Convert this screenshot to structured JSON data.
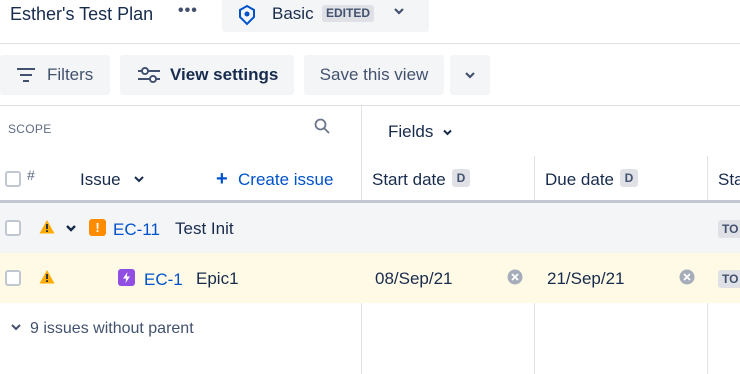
{
  "header": {
    "plan_title": "Esther's Test Plan",
    "more_label": "•••",
    "view_name": "Basic",
    "view_badge": "EDITED"
  },
  "toolbar": {
    "filters_label": "Filters",
    "view_settings_label": "View settings",
    "save_view_label": "Save this view"
  },
  "scope": {
    "label": "SCOPE",
    "hash_label": "#",
    "issue_label": "Issue",
    "create_issue_label": "Create issue"
  },
  "fields": {
    "button_label": "Fields",
    "columns": [
      {
        "label": "Start date",
        "badge": "D"
      },
      {
        "label": "Due date",
        "badge": "D"
      },
      {
        "label": "Sta"
      }
    ]
  },
  "rows": [
    {
      "key": "EC-11",
      "summary": "Test Init",
      "type_icon": "story-icon",
      "status": "TO"
    },
    {
      "key": "EC-1",
      "summary": "Epic1",
      "type_icon": "epic-icon",
      "start_date": "08/Sep/21",
      "due_date": "21/Sep/21",
      "status": "TO"
    }
  ],
  "without_parent": {
    "label": "9 issues without parent"
  },
  "colors": {
    "link": "#0052cc",
    "warning": "#ffab00",
    "story": "#ff8b00",
    "epic": "#904ee2",
    "highlight_row": "#fefae6"
  }
}
